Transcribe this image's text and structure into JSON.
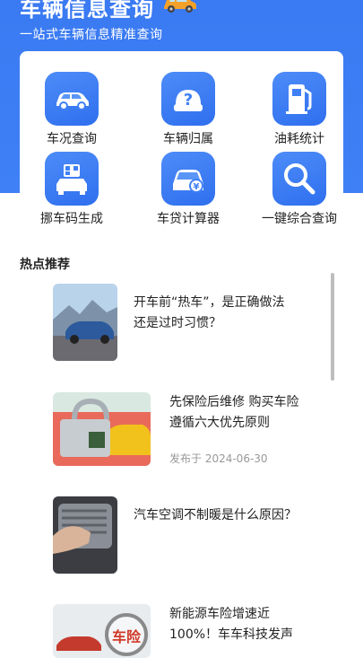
{
  "header": {
    "title": "车辆信息查询",
    "subtitle": "一站式车辆信息精准查询"
  },
  "tools": [
    {
      "label": "车况查询",
      "icon": "car-icon"
    },
    {
      "label": "车辆归属",
      "icon": "question-car-icon"
    },
    {
      "label": "油耗统计",
      "icon": "fuel-pump-icon"
    },
    {
      "label": "挪车码生成",
      "icon": "qr-car-icon"
    },
    {
      "label": "车贷计算器",
      "icon": "car-loan-icon"
    },
    {
      "label": "一键综合查询",
      "icon": "magnifier-icon"
    }
  ],
  "hot": {
    "title": "热点推荐",
    "items": [
      {
        "title": "开车前“热车”，是正确做法\n还是过时习惯？"
      },
      {
        "title": "先保险后维修 购买车险\n遵循六大优先原则",
        "date": "发布于 2024-06-30"
      },
      {
        "title": "汽车空调不制暖是什么原因？"
      },
      {
        "title": "新能源车险增速近\n100%！车车科技发声"
      }
    ]
  },
  "colors": {
    "accent": "#3f80f6"
  }
}
